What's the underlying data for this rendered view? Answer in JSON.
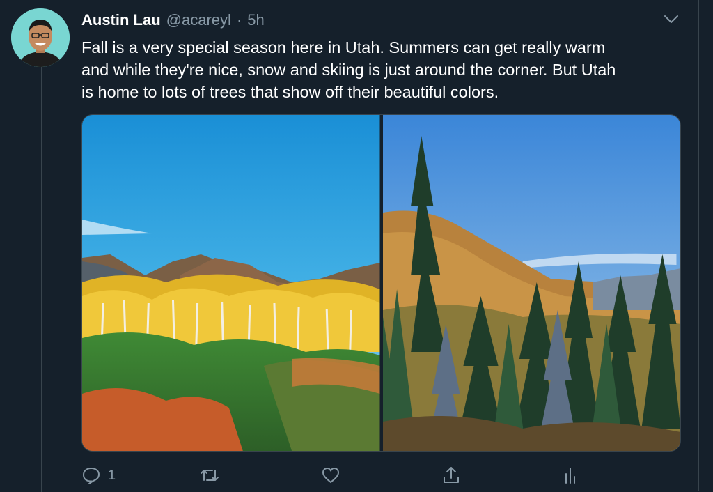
{
  "tweet": {
    "display_name": "Austin Lau",
    "handle": "@acareyl",
    "separator": "·",
    "time": "5h",
    "text": "Fall is a very special season here in Utah. Summers can get really warm\nand while they're nice, snow and skiing is just around the corner. But Utah\nis home to lots of trees that show off their beautiful colors."
  },
  "actions": {
    "reply_count": "1"
  },
  "colors": {
    "background": "#15202b",
    "secondary_text": "#8899a6",
    "border": "#38444d"
  },
  "icons": [
    "chevron-down-icon",
    "reply-icon",
    "retweet-icon",
    "like-icon",
    "share-icon",
    "analytics-icon"
  ]
}
